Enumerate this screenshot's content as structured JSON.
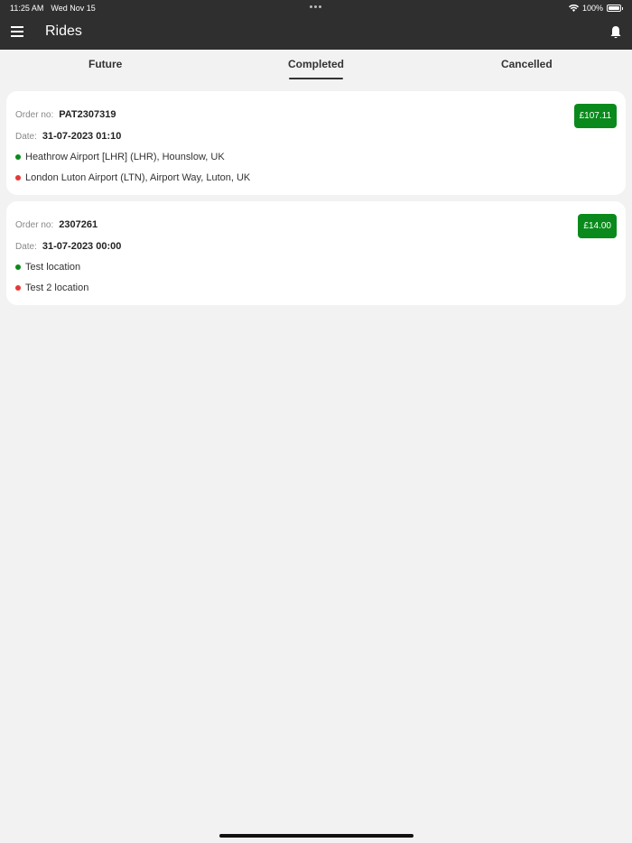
{
  "status_bar": {
    "time": "11:25 AM",
    "date": "Wed Nov 15",
    "battery": "100%"
  },
  "header": {
    "title": "Rides"
  },
  "tabs": [
    {
      "label": "Future",
      "active": false
    },
    {
      "label": "Completed",
      "active": true
    },
    {
      "label": "Cancelled",
      "active": false
    }
  ],
  "rides": [
    {
      "order_label": "Order no:",
      "order_no": "PAT2307319",
      "date_label": "Date:",
      "date": "31-07-2023 01:10",
      "pickup": "Heathrow Airport [LHR] (LHR), Hounslow, UK",
      "dropoff": "London Luton Airport (LTN), Airport Way, Luton, UK",
      "price": "£107.11"
    },
    {
      "order_label": "Order no:",
      "order_no": "2307261",
      "date_label": "Date:",
      "date": "31-07-2023 00:00",
      "pickup": "Test location",
      "dropoff": "Test 2 location",
      "price": "£14.00"
    }
  ],
  "colors": {
    "app_bar": "#2f2f2f",
    "price_badge": "#0a8a1c",
    "pickup_dot": "#0c8a1a",
    "dropoff_dot": "#e53935",
    "background": "#f2f2f2"
  }
}
